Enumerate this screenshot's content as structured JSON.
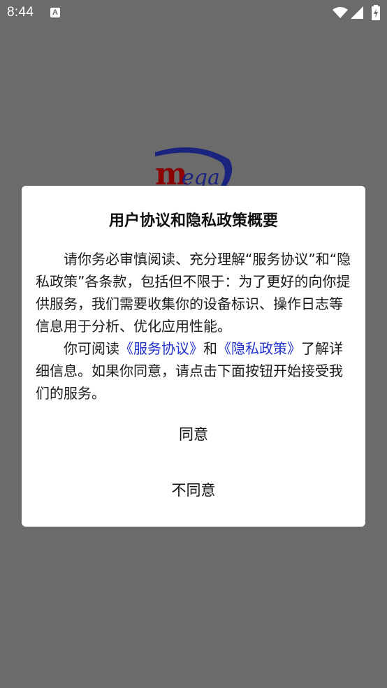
{
  "status_bar": {
    "time": "8:44",
    "notification_glyph": "A",
    "icons": [
      "notification-icon",
      "wifi-icon",
      "signal-icon",
      "battery-charging-icon"
    ]
  },
  "logo": {
    "text_m": "m",
    "text_rest": "ega",
    "colors": {
      "m": "#8b0000",
      "swoosh": "#1a237e"
    }
  },
  "dialog": {
    "title": "用户协议和隐私政策概要",
    "paragraph1": "请你务必审慎阅读、充分理解“服务协议”和“隐私政策”各条款，包括但不限于：为了更好的向你提供服务，我们需要收集你的设备标识、操作日志等信息用于分析、优化应用性能。",
    "paragraph2_prefix": "你可阅读",
    "service_link": "《服务协议》",
    "paragraph2_and": "和",
    "privacy_link": "《隐私政策》",
    "paragraph2_suffix": "了解详细信息。如果你同意，请点击下面按钮开始接受我们的服务。",
    "agree_label": "同意",
    "disagree_label": "不同意"
  },
  "colors": {
    "overlay": "#6b6b6b",
    "dialog_bg": "#ffffff",
    "link": "#2233cc"
  }
}
